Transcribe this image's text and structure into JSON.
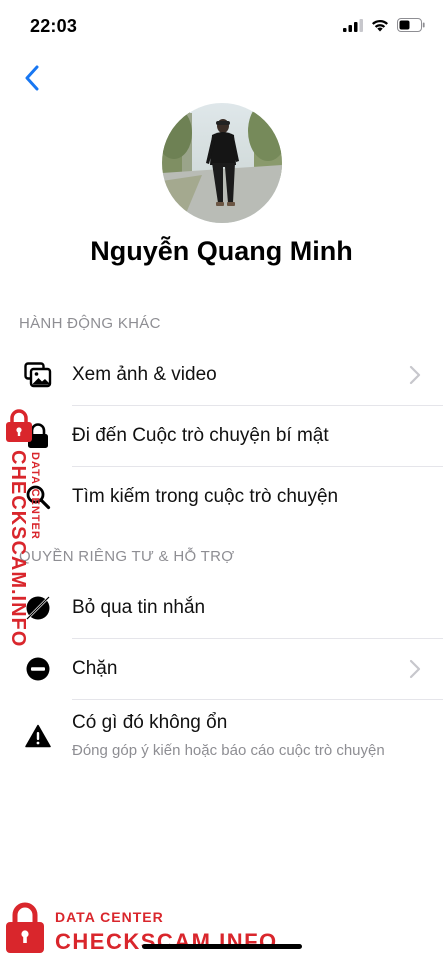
{
  "status_bar": {
    "time": "22:03"
  },
  "profile": {
    "name": "Nguyễn Quang Minh"
  },
  "sections": {
    "more_actions": {
      "header": "HÀNH ĐỘNG KHÁC",
      "items": [
        {
          "label": "Xem ảnh & video",
          "icon": "photos-icon",
          "chevron": true
        },
        {
          "label": "Đi đến Cuộc trò chuyện bí mật",
          "icon": "lock-icon",
          "chevron": false
        },
        {
          "label": "Tìm kiếm trong cuộc trò chuyện",
          "icon": "search-icon",
          "chevron": false
        }
      ]
    },
    "privacy_support": {
      "header": "QUYỀN RIÊNG TƯ & HỖ TRỢ",
      "items": [
        {
          "label": "Bỏ qua tin nhắn",
          "icon": "ignore-icon",
          "chevron": false
        },
        {
          "label": "Chặn",
          "icon": "block-icon",
          "chevron": true
        },
        {
          "label": "Có gì đó không ổn",
          "sublabel": "Đóng góp ý kiến hoặc báo cáo cuộc trò chuyện",
          "icon": "warning-icon",
          "chevron": false
        }
      ]
    }
  },
  "watermark": {
    "line1": "DATA CENTER",
    "line2": "CHECKSCAM.INFO"
  },
  "colors": {
    "accent": "#1877f2",
    "watermark": "#d9262c",
    "secondary_text": "#8e8e93"
  }
}
